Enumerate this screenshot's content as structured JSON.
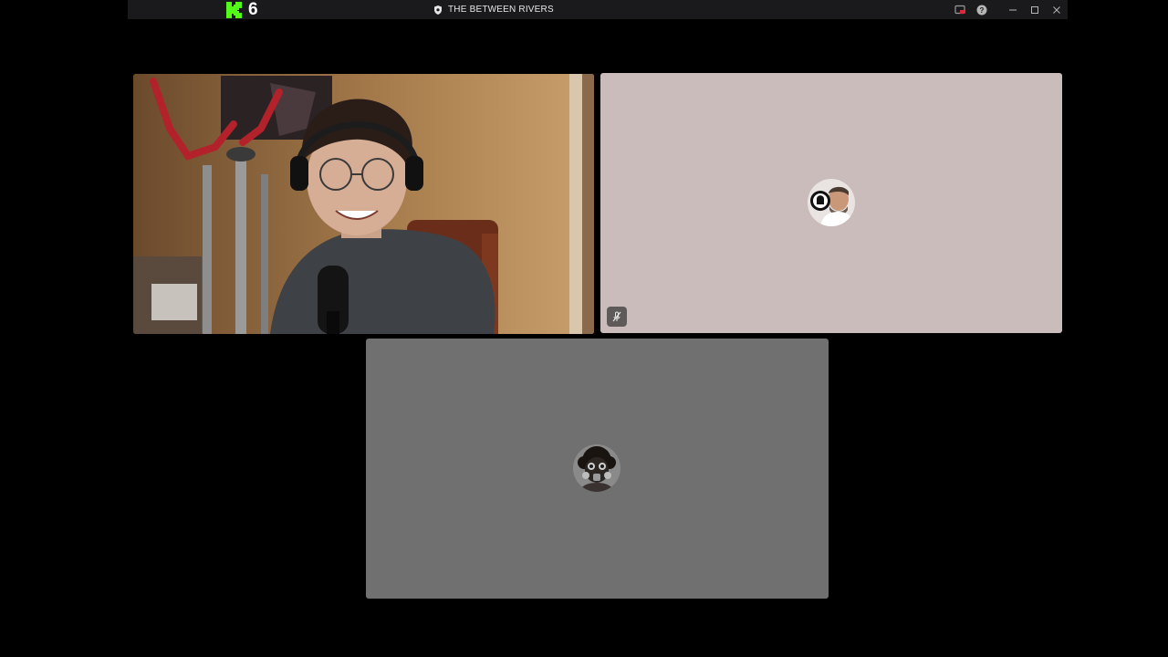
{
  "titlebar": {
    "brand_count": "6",
    "server_name": "THE BETWEEN RIVERS",
    "icons": {
      "brand": "kick-logo-icon",
      "server": "shield-icon",
      "screen": "screen-share-icon",
      "help": "help-icon",
      "minimize": "minimize-icon",
      "maximize": "maximize-icon",
      "close": "close-icon"
    }
  },
  "colors": {
    "background": "#000000",
    "titlebar": "#1a1a1c",
    "brand_green": "#53fc18",
    "tile_b": "#c9bcbb",
    "tile_c": "#707070",
    "mute_badge": "#5f5a5a"
  },
  "participants": [
    {
      "tile": "camera",
      "video_on": true
    },
    {
      "tile": "avatar",
      "video_on": false,
      "muted": true,
      "avatar_icon": "headphones-avatar-icon"
    },
    {
      "tile": "avatar",
      "video_on": false,
      "avatar_icon": "gasmask-avatar-icon"
    }
  ]
}
